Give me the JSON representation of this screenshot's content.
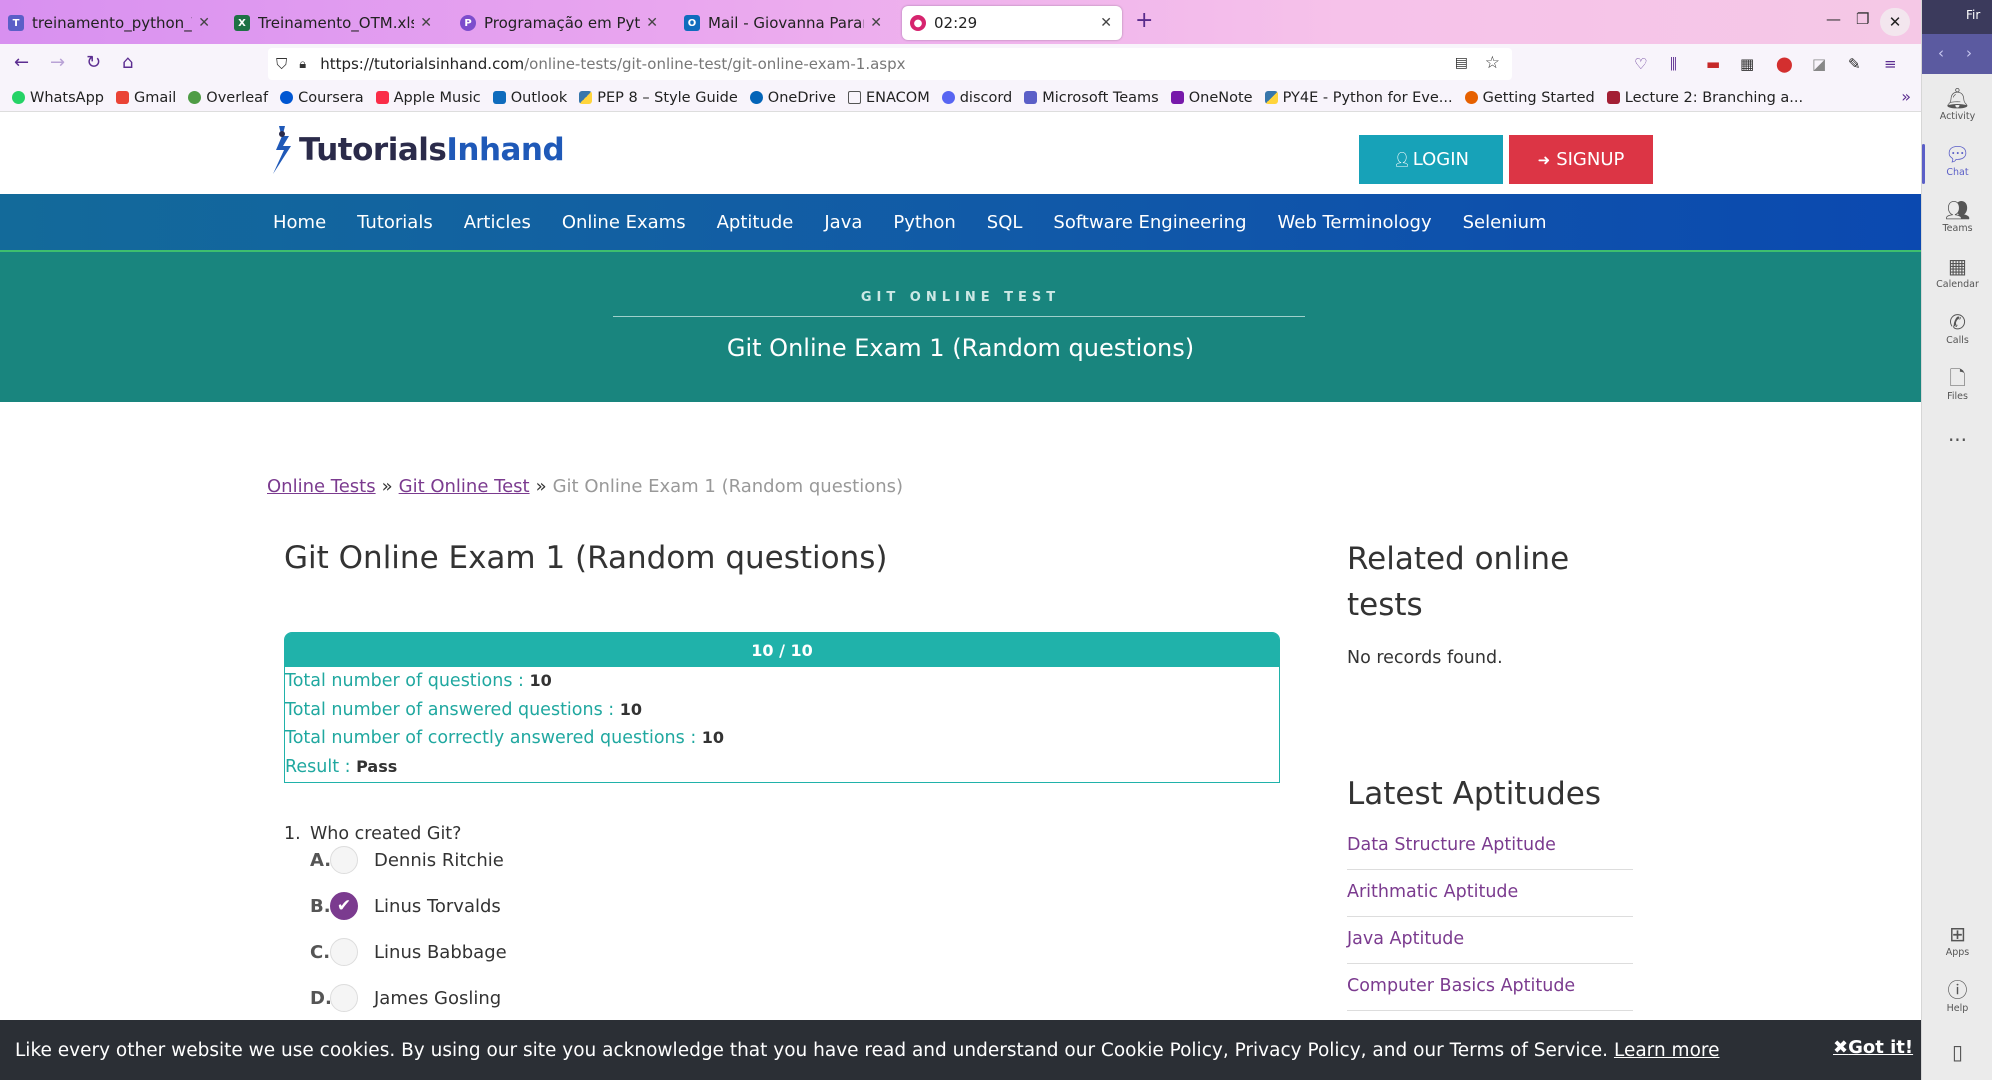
{
  "browser": {
    "tabs": [
      {
        "title": "treinamento_python_Tea",
        "color": "#5b5fc7",
        "glyph": "T"
      },
      {
        "title": "Treinamento_OTM.xlsx",
        "color": "#1e7145",
        "glyph": "X"
      },
      {
        "title": "Programação em Python",
        "color": "#7c4dcc",
        "glyph": "P"
      },
      {
        "title": "Mail - Giovanna Paranhos",
        "color": "#0f6cbd",
        "glyph": "O"
      },
      {
        "title": "02:29",
        "color": "#d6246e",
        "glyph": "●"
      }
    ],
    "url_domain": "https://tutorialsinhand.com",
    "url_path": "/online-tests/git-online-test/git-online-exam-1.aspx",
    "bookmarks": [
      {
        "label": "WhatsApp",
        "color": "#25d366"
      },
      {
        "label": "Gmail",
        "color": "#ea4335"
      },
      {
        "label": "Overleaf",
        "color": "#4f9c45"
      },
      {
        "label": "Coursera",
        "color": "#0056d2"
      },
      {
        "label": "Apple Music",
        "color": "#fa2d48"
      },
      {
        "label": "Outlook",
        "color": "#0f6cbd"
      },
      {
        "label": "PEP 8 – Style Guide",
        "color": "#3776ab"
      },
      {
        "label": "OneDrive",
        "color": "#0364b8"
      },
      {
        "label": "ENACOM",
        "color": "#888888"
      },
      {
        "label": "discord",
        "color": "#5865f2"
      },
      {
        "label": "Microsoft Teams",
        "color": "#5b5fc7"
      },
      {
        "label": "OneNote",
        "color": "#7719aa"
      },
      {
        "label": "PY4E - Python for Eve...",
        "color": "#3776ab"
      },
      {
        "label": "Getting Started",
        "color": "#e66000"
      },
      {
        "label": "Lecture 2: Branching a...",
        "color": "#a31f34"
      }
    ]
  },
  "site": {
    "logo_part1": "Tutorials",
    "logo_part2": "Inhand",
    "login": "LOGIN",
    "signup": "SIGNUP",
    "nav": [
      "Home",
      "Tutorials",
      "Articles",
      "Online Exams",
      "Aptitude",
      "Java",
      "Python",
      "SQL",
      "Software Engineering",
      "Web Terminology",
      "Selenium"
    ],
    "hero_kicker": "GIT ONLINE TEST",
    "hero_title": "Git Online Exam 1 (Random questions)",
    "breadcrumb": {
      "link1": "Online Tests",
      "link2": "Git Online Test",
      "current": "Git Online Exam 1 (Random questions)"
    },
    "page_title": "Git Online Exam 1 (Random questions)",
    "result": {
      "score": "10 / 10",
      "lines": [
        {
          "label": "Total number of questions : ",
          "value": "10"
        },
        {
          "label": "Total number of answered questions : ",
          "value": "10"
        },
        {
          "label": "Total number of correctly answered questions : ",
          "value": "10"
        },
        {
          "label": "Result : ",
          "value": "Pass"
        }
      ]
    },
    "question": {
      "number": "1.",
      "text": "Who created Git?",
      "options": [
        {
          "letter": "A.",
          "text": "Dennis Ritchie",
          "checked": false
        },
        {
          "letter": "B.",
          "text": "Linus Torvalds",
          "checked": true
        },
        {
          "letter": "C.",
          "text": "Linus Babbage",
          "checked": false
        },
        {
          "letter": "D.",
          "text": "James Gosling",
          "checked": false
        }
      ]
    },
    "sidebar": {
      "related_title": "Related online tests",
      "no_records": "No records found.",
      "latest_title": "Latest Aptitudes",
      "aptitudes": [
        "Data Structure Aptitude",
        "Arithmatic Aptitude",
        "Java Aptitude",
        "Computer Basics Aptitude"
      ]
    },
    "cookie": {
      "text": "Like every other website we use cookies. By using our site you acknowledge that you have read and understand our Cookie Policy, Privacy Policy, and our Terms of Service.",
      "learn_more": "Learn more",
      "got_it": "Got it!"
    }
  },
  "rail": {
    "top_label": "Fir",
    "items": [
      {
        "label": "Activity",
        "icon": "bell-icon"
      },
      {
        "label": "Chat",
        "icon": "chat-icon"
      },
      {
        "label": "Teams",
        "icon": "teams-icon"
      },
      {
        "label": "Calendar",
        "icon": "calendar-icon"
      },
      {
        "label": "Calls",
        "icon": "phone-icon"
      },
      {
        "label": "Files",
        "icon": "file-icon"
      }
    ],
    "apps_label": "Apps",
    "help_label": "Help"
  },
  "colors": {
    "teal": "#19857e",
    "nav_blue": "#1159a8",
    "login": "#17a2b8",
    "signup": "#dc3545",
    "link": "#7b3b8f",
    "result_accent": "#20b2aa"
  }
}
